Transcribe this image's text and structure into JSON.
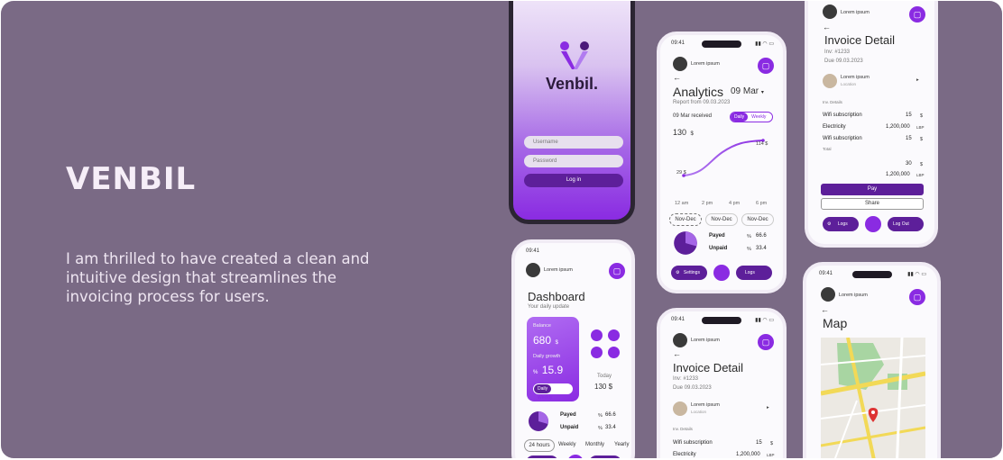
{
  "hero": {
    "title": "VENBIL",
    "description": "I am thrilled to have created a clean and intuitive design that streamlines the invoicing process for users."
  },
  "colors": {
    "background": "#7a6a85",
    "accent": "#8a2be2",
    "accent_dark": "#5d1f9a"
  },
  "common": {
    "user_name": "Lorem ipsum",
    "back": "←",
    "time": "09:41"
  },
  "login": {
    "brand": "Venbil.",
    "username_placeholder": "Username",
    "password_placeholder": "Password",
    "login_button": "Log in"
  },
  "dashboard": {
    "title": "Dashboard",
    "subtitle": "Your daily update",
    "balance_label": "Balance",
    "balance_value": "680",
    "balance_unit": "$",
    "growth_label": "Daily growth",
    "growth_prefix": "%",
    "growth_value": "15.9",
    "toggle_daily": "Daily",
    "toggle_weekly": "Weekly",
    "today_label": "Today",
    "today_value": "130 $",
    "payed_label": "Payed",
    "payed_pct": "%",
    "payed_value": "66.6",
    "unpaid_label": "Unpaid",
    "unpaid_pct": "%",
    "unpaid_value": "33.4",
    "tabs": [
      "24 hours",
      "Weekly",
      "Monthly",
      "Yearly"
    ]
  },
  "analytics": {
    "title": "Analytics",
    "date": "09 Mar",
    "report": "Report from 09.03.2023",
    "received": "09 Mar received",
    "toggle_daily": "Daily",
    "toggle_weekly": "Weekly",
    "amount": "130",
    "amount_unit": "$",
    "end_label": "114 $",
    "start_label": "29 $",
    "times": [
      "12 am",
      "2 pm",
      "4 pm",
      "6 pm"
    ],
    "ranges": [
      "Nov-Dec",
      "Nov-Dec",
      "Nov-Dec"
    ],
    "payed_label": "Payed",
    "payed_pct": "%",
    "payed_value": "66.6",
    "unpaid_label": "Unpaid",
    "unpaid_pct": "%",
    "unpaid_value": "33.4",
    "nav_settings": "Settings",
    "nav_logs": "Logs"
  },
  "invoice": {
    "title": "Invoice Detail",
    "inv": "Inv: #1233",
    "due": "Due 09.03.2023",
    "client_name": "Lorem ipsum",
    "client_location": "Location",
    "details_label": "Inv. Details",
    "items": [
      {
        "name": "Wifi subscription",
        "qty": "15",
        "unit": "$"
      },
      {
        "name": "Electricity",
        "qty": "1,200,000",
        "unit": "LBP"
      },
      {
        "name": "Wifi subscription",
        "qty": "15",
        "unit": "$"
      }
    ],
    "total_label": "Total",
    "total_usd": "30",
    "total_usd_unit": "$",
    "total_lbp": "1,200,000",
    "total_lbp_unit": "LBP",
    "pay_button": "Pay",
    "share_button": "Share",
    "nav_logs": "Logs",
    "nav_logout": "Log Out"
  },
  "map": {
    "title": "Map"
  }
}
